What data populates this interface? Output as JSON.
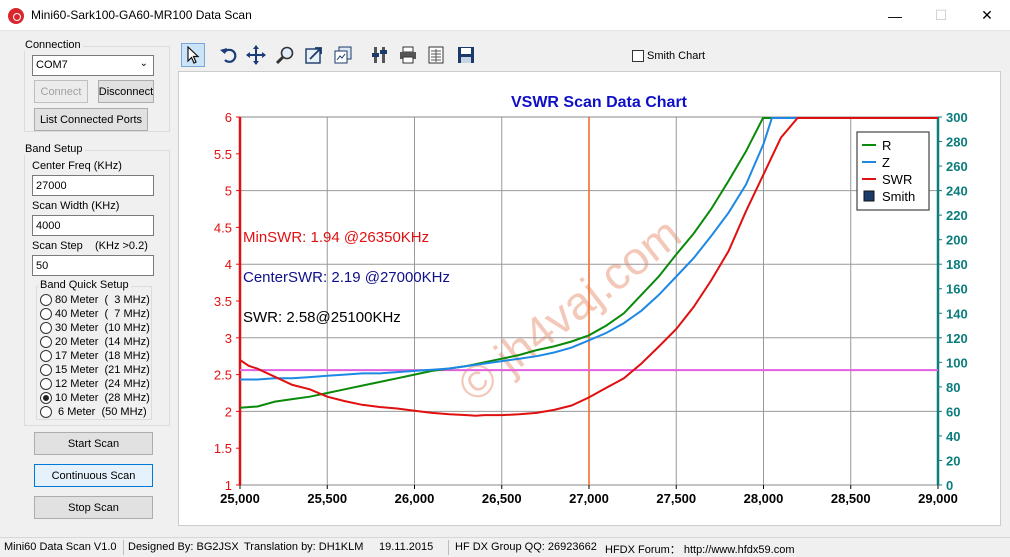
{
  "window": {
    "title": "Mini60-Sark100-GA60-MR100 Data Scan",
    "minimize": "—",
    "maximize": "☐",
    "close": "✕"
  },
  "connection": {
    "label": "Connection",
    "port": "COM7",
    "connect": "Connect",
    "disconnect": "Disconnect",
    "list_ports": "List Connected Ports"
  },
  "band_setup": {
    "label": "Band Setup",
    "center_freq_label": "Center Freq  (KHz)",
    "center_freq": "27000",
    "scan_width_label": "Scan Width   (KHz)",
    "scan_width": "4000",
    "scan_step_label": "Scan Step",
    "scan_step_hint": "(KHz >0.2)",
    "scan_step": "50",
    "quick_label": "Band Quick Setup",
    "bands": [
      {
        "label": "80 Meter  (  3 MHz)",
        "selected": false
      },
      {
        "label": "40 Meter  (  7 MHz)",
        "selected": false
      },
      {
        "label": "30 Meter  (10 MHz)",
        "selected": false
      },
      {
        "label": "20 Meter  (14 MHz)",
        "selected": false
      },
      {
        "label": "17 Meter  (18 MHz)",
        "selected": false
      },
      {
        "label": "15 Meter  (21 MHz)",
        "selected": false
      },
      {
        "label": "12 Meter  (24 MHz)",
        "selected": false
      },
      {
        "label": "10 Meter  (28 MHz)",
        "selected": true
      },
      {
        "label": " 6 Meter  (50 MHz)",
        "selected": false
      }
    ]
  },
  "actions": {
    "start": "Start Scan",
    "continuous": "Continuous Scan",
    "stop": "Stop Scan"
  },
  "toolbar": {
    "tools": [
      "pointer-icon",
      "undo-icon",
      "pan-icon",
      "zoom-icon",
      "export-icon",
      "copy-chart-icon",
      "settings-icon",
      "print-icon",
      "data-table-icon",
      "save-icon"
    ],
    "smith_chart_label": "Smith Chart",
    "smith_chart_checked": false
  },
  "chart_data": {
    "type": "line",
    "title": "VSWR Scan Data Chart",
    "title_color": "#0f0fc8",
    "xlim": [
      25000,
      29000
    ],
    "x_ticks": [
      "25,000",
      "25,500",
      "26,000",
      "26,500",
      "27,000",
      "27,500",
      "28,000",
      "28,500",
      "29,000"
    ],
    "y_left_lim": [
      1,
      6
    ],
    "y_left_ticks": [
      "1",
      "1.5",
      "2",
      "2.5",
      "3",
      "3.5",
      "4",
      "4.5",
      "5",
      "5.5",
      "6"
    ],
    "y_right_lim": [
      0,
      300
    ],
    "y_right_ticks": [
      "0",
      "20",
      "40",
      "60",
      "80",
      "100",
      "120",
      "140",
      "160",
      "180",
      "200",
      "220",
      "240",
      "260",
      "280",
      "300"
    ],
    "center_marker_x": 27000,
    "reference_line_y": 2.56,
    "annotations": [
      {
        "text": "MinSWR: 1.94 @26350KHz",
        "color": "#e01010"
      },
      {
        "text": "CenterSWR: 2.19 @27000KHz",
        "color": "#10108a"
      },
      {
        "text": "SWR: 2.58@25100KHz",
        "color": "#000000"
      }
    ],
    "legend": [
      {
        "name": "R",
        "color": "#0a8a0a"
      },
      {
        "name": "Z",
        "color": "#1e88e5"
      },
      {
        "name": "SWR",
        "color": "#e01010"
      },
      {
        "name": "Smith",
        "color": "#1a3a6a"
      }
    ],
    "legend_position": "top-right",
    "grid": true,
    "series": [
      {
        "name": "R",
        "axis": "right",
        "color": "#0a8a0a",
        "x": [
          25000,
          25100,
          25200,
          25300,
          25400,
          25500,
          25600,
          25700,
          25800,
          25900,
          26000,
          26100,
          26200,
          26300,
          26400,
          26500,
          26600,
          26700,
          26800,
          26900,
          27000,
          27100,
          27200,
          27300,
          27400,
          27500,
          27600,
          27700,
          27800,
          27900,
          28000
        ],
        "y": [
          63,
          64,
          68,
          70,
          72,
          75,
          78,
          81,
          84,
          87,
          90,
          93,
          95,
          97,
          100,
          103,
          106,
          110,
          113,
          117,
          122,
          130,
          140,
          155,
          170,
          188,
          205,
          225,
          248,
          272,
          300
        ]
      },
      {
        "name": "Z",
        "axis": "right",
        "color": "#1e88e5",
        "x": [
          25000,
          25100,
          25200,
          25300,
          25400,
          25500,
          25600,
          25700,
          25800,
          25900,
          26000,
          26100,
          26200,
          26300,
          26400,
          26500,
          26600,
          26700,
          26800,
          26900,
          27000,
          27100,
          27200,
          27300,
          27400,
          27500,
          27600,
          27700,
          27800,
          27900,
          28000,
          28050
        ],
        "y": [
          86,
          86,
          87,
          87,
          88,
          89,
          90,
          91,
          91,
          92,
          93,
          94,
          95,
          97,
          99,
          101,
          103,
          105,
          108,
          112,
          118,
          124,
          132,
          142,
          155,
          170,
          185,
          203,
          222,
          245,
          278,
          300
        ]
      },
      {
        "name": "SWR",
        "axis": "left",
        "color": "#e01010",
        "x": [
          25000,
          25050,
          25100,
          25200,
          25300,
          25400,
          25500,
          25600,
          25700,
          25800,
          25900,
          26000,
          26100,
          26200,
          26300,
          26350,
          26400,
          26500,
          26600,
          26700,
          26800,
          26900,
          27000,
          27100,
          27200,
          27300,
          27400,
          27500,
          27600,
          27700,
          27800,
          27900,
          28000,
          28100,
          28200
        ],
        "y": [
          2.7,
          2.62,
          2.58,
          2.47,
          2.36,
          2.3,
          2.2,
          2.14,
          2.09,
          2.06,
          2.04,
          2.01,
          1.98,
          1.96,
          1.95,
          1.94,
          1.95,
          1.95,
          1.96,
          1.98,
          2.02,
          2.08,
          2.19,
          2.32,
          2.45,
          2.65,
          2.88,
          3.12,
          3.42,
          3.78,
          4.18,
          4.72,
          5.22,
          5.72,
          6.0
        ]
      }
    ]
  },
  "status": {
    "version": "Mini60 Data Scan V1.0",
    "designed": "Designed By: BG2JSX",
    "translation": "Translation by: DH1KLM",
    "date": "19.11.2015",
    "group": "HF DX Group QQ: 26923662",
    "forum": "HFDX Forum： http://www.hfdx59.com"
  },
  "watermark": "© jh4vaj.com"
}
